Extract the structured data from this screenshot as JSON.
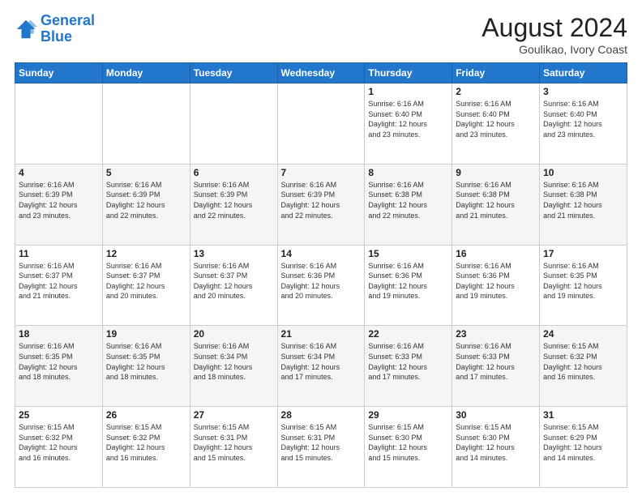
{
  "header": {
    "logo_line1": "General",
    "logo_line2": "Blue",
    "title": "August 2024",
    "subtitle": "Goulikao, Ivory Coast"
  },
  "weekdays": [
    "Sunday",
    "Monday",
    "Tuesday",
    "Wednesday",
    "Thursday",
    "Friday",
    "Saturday"
  ],
  "weeks": [
    [
      {
        "day": "",
        "text": ""
      },
      {
        "day": "",
        "text": ""
      },
      {
        "day": "",
        "text": ""
      },
      {
        "day": "",
        "text": ""
      },
      {
        "day": "1",
        "text": "Sunrise: 6:16 AM\nSunset: 6:40 PM\nDaylight: 12 hours\nand 23 minutes."
      },
      {
        "day": "2",
        "text": "Sunrise: 6:16 AM\nSunset: 6:40 PM\nDaylight: 12 hours\nand 23 minutes."
      },
      {
        "day": "3",
        "text": "Sunrise: 6:16 AM\nSunset: 6:40 PM\nDaylight: 12 hours\nand 23 minutes."
      }
    ],
    [
      {
        "day": "4",
        "text": "Sunrise: 6:16 AM\nSunset: 6:39 PM\nDaylight: 12 hours\nand 23 minutes."
      },
      {
        "day": "5",
        "text": "Sunrise: 6:16 AM\nSunset: 6:39 PM\nDaylight: 12 hours\nand 22 minutes."
      },
      {
        "day": "6",
        "text": "Sunrise: 6:16 AM\nSunset: 6:39 PM\nDaylight: 12 hours\nand 22 minutes."
      },
      {
        "day": "7",
        "text": "Sunrise: 6:16 AM\nSunset: 6:39 PM\nDaylight: 12 hours\nand 22 minutes."
      },
      {
        "day": "8",
        "text": "Sunrise: 6:16 AM\nSunset: 6:38 PM\nDaylight: 12 hours\nand 22 minutes."
      },
      {
        "day": "9",
        "text": "Sunrise: 6:16 AM\nSunset: 6:38 PM\nDaylight: 12 hours\nand 21 minutes."
      },
      {
        "day": "10",
        "text": "Sunrise: 6:16 AM\nSunset: 6:38 PM\nDaylight: 12 hours\nand 21 minutes."
      }
    ],
    [
      {
        "day": "11",
        "text": "Sunrise: 6:16 AM\nSunset: 6:37 PM\nDaylight: 12 hours\nand 21 minutes."
      },
      {
        "day": "12",
        "text": "Sunrise: 6:16 AM\nSunset: 6:37 PM\nDaylight: 12 hours\nand 20 minutes."
      },
      {
        "day": "13",
        "text": "Sunrise: 6:16 AM\nSunset: 6:37 PM\nDaylight: 12 hours\nand 20 minutes."
      },
      {
        "day": "14",
        "text": "Sunrise: 6:16 AM\nSunset: 6:36 PM\nDaylight: 12 hours\nand 20 minutes."
      },
      {
        "day": "15",
        "text": "Sunrise: 6:16 AM\nSunset: 6:36 PM\nDaylight: 12 hours\nand 19 minutes."
      },
      {
        "day": "16",
        "text": "Sunrise: 6:16 AM\nSunset: 6:36 PM\nDaylight: 12 hours\nand 19 minutes."
      },
      {
        "day": "17",
        "text": "Sunrise: 6:16 AM\nSunset: 6:35 PM\nDaylight: 12 hours\nand 19 minutes."
      }
    ],
    [
      {
        "day": "18",
        "text": "Sunrise: 6:16 AM\nSunset: 6:35 PM\nDaylight: 12 hours\nand 18 minutes."
      },
      {
        "day": "19",
        "text": "Sunrise: 6:16 AM\nSunset: 6:35 PM\nDaylight: 12 hours\nand 18 minutes."
      },
      {
        "day": "20",
        "text": "Sunrise: 6:16 AM\nSunset: 6:34 PM\nDaylight: 12 hours\nand 18 minutes."
      },
      {
        "day": "21",
        "text": "Sunrise: 6:16 AM\nSunset: 6:34 PM\nDaylight: 12 hours\nand 17 minutes."
      },
      {
        "day": "22",
        "text": "Sunrise: 6:16 AM\nSunset: 6:33 PM\nDaylight: 12 hours\nand 17 minutes."
      },
      {
        "day": "23",
        "text": "Sunrise: 6:16 AM\nSunset: 6:33 PM\nDaylight: 12 hours\nand 17 minutes."
      },
      {
        "day": "24",
        "text": "Sunrise: 6:15 AM\nSunset: 6:32 PM\nDaylight: 12 hours\nand 16 minutes."
      }
    ],
    [
      {
        "day": "25",
        "text": "Sunrise: 6:15 AM\nSunset: 6:32 PM\nDaylight: 12 hours\nand 16 minutes."
      },
      {
        "day": "26",
        "text": "Sunrise: 6:15 AM\nSunset: 6:32 PM\nDaylight: 12 hours\nand 16 minutes."
      },
      {
        "day": "27",
        "text": "Sunrise: 6:15 AM\nSunset: 6:31 PM\nDaylight: 12 hours\nand 15 minutes."
      },
      {
        "day": "28",
        "text": "Sunrise: 6:15 AM\nSunset: 6:31 PM\nDaylight: 12 hours\nand 15 minutes."
      },
      {
        "day": "29",
        "text": "Sunrise: 6:15 AM\nSunset: 6:30 PM\nDaylight: 12 hours\nand 15 minutes."
      },
      {
        "day": "30",
        "text": "Sunrise: 6:15 AM\nSunset: 6:30 PM\nDaylight: 12 hours\nand 14 minutes."
      },
      {
        "day": "31",
        "text": "Sunrise: 6:15 AM\nSunset: 6:29 PM\nDaylight: 12 hours\nand 14 minutes."
      }
    ]
  ]
}
